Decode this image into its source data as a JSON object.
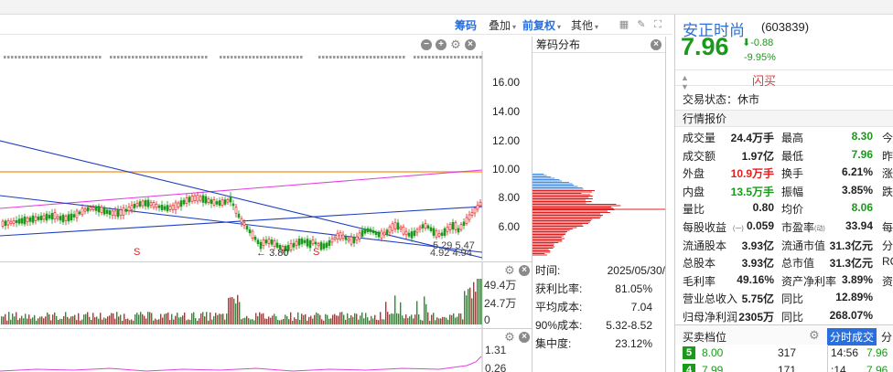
{
  "toolbar": {
    "chips_label": "筹码",
    "overlay_label": "叠加",
    "adjust_label": "前复权",
    "other_label": "其他"
  },
  "main_chart": {
    "y_labels": [
      "16.00",
      "14.00",
      "12.00",
      "10.00",
      "8.00",
      "6.00"
    ],
    "annotations": {
      "low_label": "3.80",
      "s_marks": [
        "S",
        "S"
      ],
      "right_a": "5.29",
      "right_b": "5.47",
      "right_c": "4.92",
      "right_d": "4.94"
    }
  },
  "volume_chart": {
    "y_labels": [
      "49.4万",
      "24.7万",
      "0"
    ]
  },
  "indicator_chart": {
    "y_labels": [
      "1.31",
      "0.26"
    ]
  },
  "chip_panel": {
    "title": "筹码分布",
    "stats": [
      {
        "label": "时间:",
        "value": "2025/05/30/"
      },
      {
        "label": "获利比率:",
        "value": "81.05%"
      },
      {
        "label": "平均成本:",
        "value": "7.04"
      },
      {
        "label": "90%成本:",
        "value": "5.32-8.52"
      },
      {
        "label": "集中度:",
        "value": "23.12%"
      }
    ]
  },
  "quote": {
    "name": "安正时尚",
    "code": "(603839)",
    "price": "7.96",
    "change": "-0.88",
    "change_pct": "-9.95%",
    "flash_buy": "闪买",
    "status_label": "交易状态：休市",
    "section_title": "行情报价",
    "rows": [
      {
        "l1": "成交量",
        "v1": "24.4万手",
        "l2": "最高",
        "v2": "8.30",
        "l3": "今",
        "c2": "grn"
      },
      {
        "l1": "成交额",
        "v1": "1.97亿",
        "l2": "最低",
        "v2": "7.96",
        "l3": "昨",
        "c2": "grn"
      },
      {
        "l1": "外盘",
        "v1": "10.9万手",
        "l2": "换手",
        "v2": "6.21%",
        "l3": "涨",
        "c1": "red"
      },
      {
        "l1": "内盘",
        "v1": "13.5万手",
        "l2": "振幅",
        "v2": "3.85%",
        "l3": "跌",
        "c1": "grn"
      },
      {
        "l1": "量比",
        "v1": "0.80",
        "l2": "均价",
        "v2": "8.06",
        "l3": "",
        "c2": "grn"
      },
      {
        "l1": "每股收益",
        "v1": "0.059",
        "l2": "市盈率",
        "v2": "33.94",
        "l3": "每",
        "sub1": "(一)",
        "sub2": "(动)"
      },
      {
        "l1": "流通股本",
        "v1": "3.93亿",
        "l2": "流通市值",
        "v2": "31.3亿元",
        "l3": "分"
      },
      {
        "l1": "总股本",
        "v1": "3.93亿",
        "l2": "总市值",
        "v2": "31.3亿元",
        "l3": "RC"
      },
      {
        "l1": "毛利率",
        "v1": "49.16%",
        "l2": "资产净利率",
        "v2": "3.89%",
        "l3": "资"
      },
      {
        "l1": "营业总收入",
        "v1": "5.75亿",
        "l2": "同比",
        "v2": "12.89%",
        "l3": ""
      },
      {
        "l1": "归母净利润",
        "v1": "2305万",
        "l2": "同比",
        "v2": "268.07%",
        "l3": ""
      }
    ],
    "order_title": "买卖档位",
    "tab_ticks": "分时成交",
    "tab_other": "分",
    "asks": [
      {
        "level": "5",
        "price": "8.00",
        "volume": "317"
      },
      {
        "level": "4",
        "price": "7.99",
        "volume": "171"
      }
    ],
    "ticks": [
      {
        "time": "14:56",
        "price": "7.96"
      },
      {
        "time": ":14",
        "price": "7.96"
      }
    ]
  },
  "colors": {
    "up": "#e01f1f",
    "down": "#1a9a1a",
    "accent": "#2a6fdb"
  }
}
